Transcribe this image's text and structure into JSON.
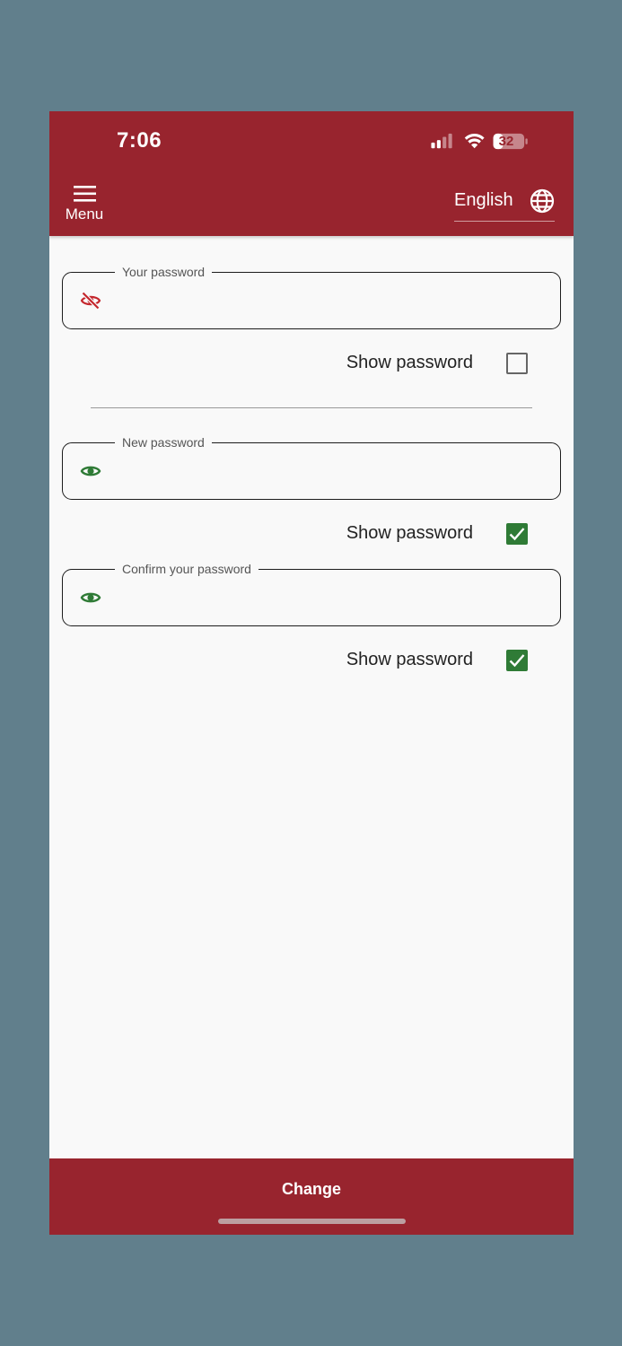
{
  "status_bar": {
    "time": "7:06",
    "battery": "32",
    "icons": [
      "signal-icon",
      "wifi-icon",
      "battery-icon"
    ]
  },
  "header": {
    "menu_label": "Menu",
    "language_label": "English",
    "icons": [
      "menu-icon",
      "globe-icon"
    ]
  },
  "form": {
    "current_password": {
      "legend": "Your password",
      "value": "",
      "visibility_icon": "eye-off-icon",
      "show_label": "Show password",
      "show_checked": false
    },
    "new_password": {
      "legend": "New password",
      "value": "",
      "visibility_icon": "eye-icon",
      "show_label": "Show password",
      "show_checked": true
    },
    "confirm_password": {
      "legend": "Confirm your password",
      "value": "",
      "visibility_icon": "eye-icon",
      "show_label": "Show password",
      "show_checked": true
    }
  },
  "footer": {
    "submit_label": "Change"
  },
  "colors": {
    "brand": "#98242e",
    "checkbox_on": "#2f7b36",
    "eye_visible": "#2f7b36",
    "eye_hidden": "#c4262c",
    "background": "#617f8c"
  }
}
